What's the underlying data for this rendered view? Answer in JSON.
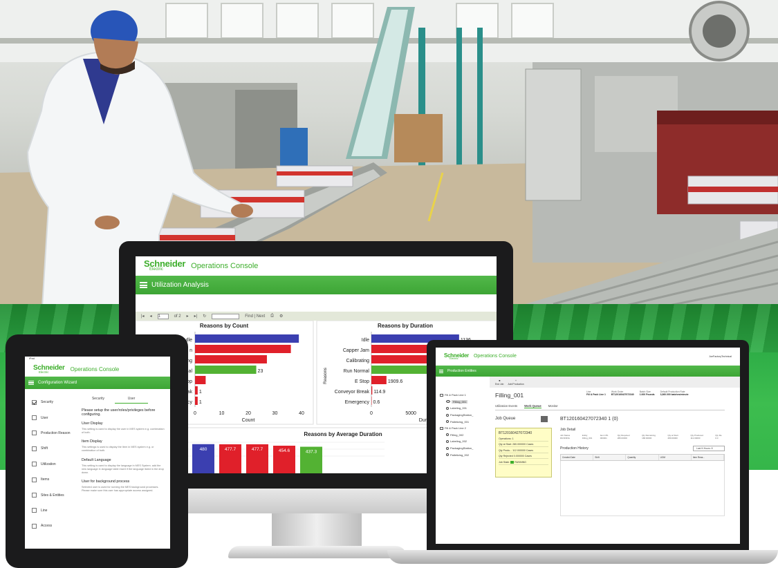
{
  "colors": {
    "brand_green": "#3dae2b",
    "bar_blue": "#3b3fb0",
    "bar_red": "#e0202a",
    "bar_green": "#53b233"
  },
  "monitor": {
    "brand": {
      "logo": "Schneider",
      "logo_sub": "Electric",
      "app_title": "Operations Console"
    },
    "menu_title": "Utilization Analysis",
    "toolbar": {
      "page": "1",
      "of_pages": "of 2",
      "find_next": "Find | Next"
    },
    "charts": [
      {
        "type": "bar",
        "orientation": "horizontal",
        "title": "Reasons by Count",
        "xlabel": "Count",
        "categories": [
          "Idle",
          "Run Normal",
          "Calibrating",
          "Normal",
          "E Stop",
          "Conveyor Break",
          "Emergency"
        ],
        "visible_categories": [
          "dle",
          "n",
          "ng",
          "nal",
          "op",
          "eak",
          "ncy"
        ],
        "values": [
          39,
          36,
          27,
          23,
          4,
          1,
          1
        ],
        "data_labels": [
          "",
          "",
          "",
          "23",
          "",
          "1",
          "1"
        ],
        "colors": [
          "blue",
          "red",
          "red",
          "green",
          "red",
          "red",
          "red"
        ],
        "xticks": [
          "0",
          "10",
          "20",
          "30",
          "40"
        ],
        "xlim": [
          0,
          40
        ]
      },
      {
        "type": "bar",
        "orientation": "horizontal",
        "title": "Reasons by Duration",
        "xlabel": "Duratio",
        "ylabel": "Reasons",
        "categories": [
          "Idle",
          "Capper Jam",
          "Calibrating",
          "Run Normal",
          "E Stop",
          "Conveyor Break",
          "Emergency"
        ],
        "values": [
          11100,
          10700,
          10000,
          10056.9,
          1909.6,
          114.9,
          0.6
        ],
        "data_labels": [
          "1136",
          "10717.4",
          "10028.7",
          "10056.9",
          "1909.6",
          "114.9",
          "0.6"
        ],
        "colors": [
          "blue",
          "red",
          "red",
          "green",
          "red",
          "red",
          "red"
        ],
        "xticks": [
          "0",
          "5000",
          "10000"
        ],
        "xlim": [
          0,
          14000
        ]
      },
      {
        "type": "bar",
        "orientation": "vertical",
        "title": "Reasons by Average Duration",
        "values": [
          480,
          477.7,
          477.7,
          454.6,
          437.3
        ],
        "data_labels": [
          "480",
          "477.7",
          "477.7",
          "454.6",
          "437.3"
        ],
        "colors": [
          "blue",
          "red",
          "red",
          "red",
          "green"
        ],
        "ylim": [
          0,
          500
        ]
      }
    ]
  },
  "tablet": {
    "status": "iPad",
    "brand": {
      "logo": "Schneider",
      "logo_sub": "Electric",
      "app_title": "Operations Console"
    },
    "menu_title": "Configuration Wizard",
    "steps": [
      {
        "label": "Security",
        "checked": true
      },
      {
        "label": "User",
        "checked": false
      },
      {
        "label": "Production Reason",
        "checked": false
      },
      {
        "label": "Shift",
        "checked": false
      },
      {
        "label": "Utilization",
        "checked": false
      },
      {
        "label": "Items",
        "checked": false
      },
      {
        "label": "Sites & Entities",
        "checked": false
      },
      {
        "label": "Line",
        "checked": false
      },
      {
        "label": "Access",
        "checked": false
      }
    ],
    "tabs": [
      "Security",
      "User"
    ],
    "intro": "Please setup the user/roles/privileges before configuring.",
    "sections": [
      {
        "title": "User Display",
        "desc": "This setting is used to display the user in MES system e.g. combination of both."
      },
      {
        "title": "Item Display",
        "desc": "This settings is used to display the Item in MES system e.g. or combination of both."
      },
      {
        "title": "Default Language",
        "desc": "This setting is used to display the language in MES System. add the new language in language table insert if the language listed in the drop down."
      },
      {
        "title": "User for background process",
        "desc": "Selected user is used for running the MES background processes. Please make sure this user has appropriate access assigned."
      }
    ]
  },
  "laptop": {
    "brand": {
      "logo": "Schneider",
      "logo_sub": "Electric",
      "app_title": "Operations Console"
    },
    "user": "JoeFactoryTechnical",
    "menu_title": "Production Entities",
    "tree": [
      {
        "label": "Fill & Pack Line 1",
        "level": 0
      },
      {
        "label": "Filling_001",
        "level": 1,
        "selected": true
      },
      {
        "label": "Labeling_001",
        "level": 1
      },
      {
        "label": "PackagingStation_",
        "level": 1
      },
      {
        "label": "Palletizing_001",
        "level": 1
      },
      {
        "label": "Fill & Pack Line 2",
        "level": 0
      },
      {
        "label": "Filling_002",
        "level": 1
      },
      {
        "label": "Labeling_002",
        "level": 1
      },
      {
        "label": "PackagingStation_",
        "level": 1
      },
      {
        "label": "Palletizing_002",
        "level": 1
      }
    ],
    "actions": [
      "End Job",
      "Add Production"
    ],
    "entity_title": "Filling_001",
    "header": [
      {
        "label": "Line",
        "value": "Fill & Pack Line 1"
      },
      {
        "label": "Work Order",
        "value": "BT120160427072340"
      },
      {
        "label": "Batch Size",
        "value": "1.000 Pounds"
      },
      {
        "label": "Default Production Rate",
        "value": "3,360.000 batches/minute"
      }
    ],
    "tabs": [
      "Utilization Events",
      "Work Queue",
      "Monitor"
    ],
    "active_tab": "Work Queue",
    "job_queue_title": "Job Queue",
    "job_card": {
      "id": "BT120160427072340",
      "rows": [
        "Operations: 1",
        "Qty at Start: 280.000000 Cases",
        "Qty Produ... 112.000000 Cases",
        "Qty Rejected 0.000000 Cases"
      ],
      "state_label": "Job State:",
      "state": "RUNNING"
    },
    "job_title": "BT120160427072340  1  (0)",
    "job_detail_title": "Job Detail",
    "job_detail": [
      "Job Status RUNNING",
      "Entity Filling_001",
      "Item CB-000001",
      "Qty Required 280.00000",
      "Qty Remaining 168.00000",
      "Qty at Start 280.00000",
      "Qty Produced 112.00000",
      "Qty Re 0.0"
    ],
    "history_title": "Production History",
    "history_filter": "Last N Hours: 8",
    "history_columns": [
      "Created Date",
      "Shift",
      "Quantity",
      "UOM",
      "Item Reas..."
    ]
  }
}
